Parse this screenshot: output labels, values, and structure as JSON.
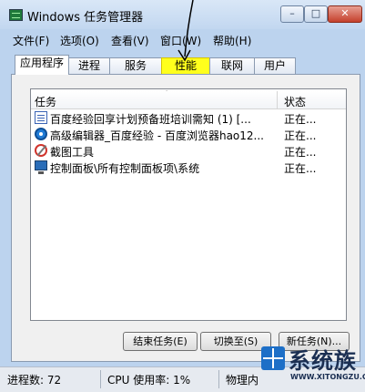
{
  "window": {
    "title": "Windows 任务管理器",
    "controls": {
      "minimize": "–",
      "maximize": "□",
      "close": "✕"
    }
  },
  "menu": [
    "文件(F)",
    "选项(O)",
    "查看(V)",
    "窗口(W)",
    "帮助(H)"
  ],
  "tabs": [
    {
      "label": "应用程序",
      "active": true
    },
    {
      "label": "进程"
    },
    {
      "label": "服务"
    },
    {
      "label": "性能",
      "highlighted": true
    },
    {
      "label": "联网"
    },
    {
      "label": "用户"
    }
  ],
  "task_list": {
    "columns": {
      "task": "任务",
      "status": "状态"
    },
    "rows": [
      {
        "name": "百度经验回享计划预备班培训需知 (1) [...",
        "status": "正在...",
        "icon": "document-icon"
      },
      {
        "name": "高级编辑器_百度经验 - 百度浏览器hao12...",
        "status": "正在...",
        "icon": "browser-icon"
      },
      {
        "name": "截图工具",
        "status": "正在...",
        "icon": "snipping-tool-icon"
      },
      {
        "name": "控制面板\\所有控制面板项\\系统",
        "status": "正在...",
        "icon": "control-panel-icon"
      }
    ]
  },
  "buttons": {
    "end_task": "结束任务(E)",
    "switch_to": "切换至(S)",
    "new_task": "新任务(N)..."
  },
  "statusbar": {
    "processes": "进程数: 72",
    "cpu": "CPU 使用率: 1%",
    "memory": "物理内"
  },
  "watermark": {
    "text": "系统族",
    "url": "WWW.XITONGZU.COM"
  },
  "colors": {
    "highlight": "#ffff1c",
    "accent": "#1d6fc7"
  }
}
